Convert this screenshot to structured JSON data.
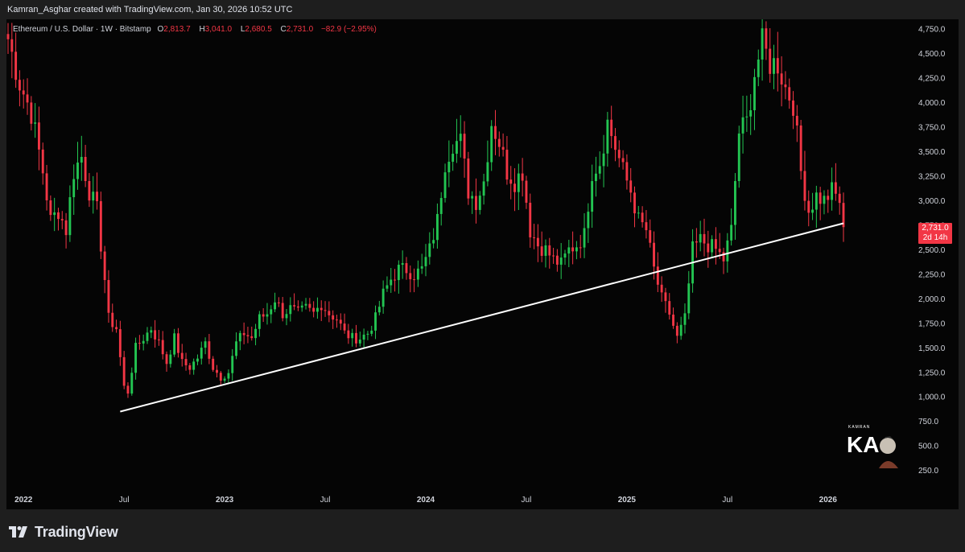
{
  "header": {
    "credit": "Kamran_Asghar created with TradingView.com, Jan 30, 2026 10:52 UTC"
  },
  "legend": {
    "symbol": "Ethereum / U.S. Dollar · 1W · Bitstamp",
    "open_label": "O",
    "open": "2,813.7",
    "high_label": "H",
    "high": "3,041.0",
    "low_label": "L",
    "low": "2,680.5",
    "close_label": "C",
    "close": "2,731.0",
    "change": "−82.9 (−2.95%)"
  },
  "price_tag": {
    "price": "2,731.0",
    "countdown": "2d 14h"
  },
  "watermark": {
    "text_top": "KAMRAN",
    "initials": "KA"
  },
  "footer": {
    "brand": "TradingView"
  },
  "colors": {
    "up": "#23c552",
    "down": "#f23645",
    "background": "#050505",
    "trendline": "#ffffff",
    "axis_text": "#d1d4dc"
  },
  "chart_data": {
    "type": "candlestick",
    "ylim": [
      50,
      4850
    ],
    "y_ticks": [
      250,
      500,
      750,
      1000,
      1250,
      1500,
      1750,
      2000,
      2250,
      2500,
      2750,
      3000,
      3250,
      3500,
      3750,
      4000,
      4250,
      4500,
      4750
    ],
    "y_tick_labels": [
      "250.0",
      "500.0",
      "750.0",
      "1,000.0",
      "1,250.0",
      "1,500.0",
      "1,750.0",
      "2,000.0",
      "2,250.0",
      "2,500.0",
      "2,750.0",
      "3,000.0",
      "3,250.0",
      "3,500.0",
      "3,750.0",
      "4,000.0",
      "4,250.0",
      "4,500.0",
      "4,750.0"
    ],
    "x_labels": [
      {
        "label": "2022",
        "index": 4,
        "bold": true
      },
      {
        "label": "Jul",
        "index": 30,
        "bold": false
      },
      {
        "label": "2023",
        "index": 56,
        "bold": true
      },
      {
        "label": "Jul",
        "index": 82,
        "bold": false
      },
      {
        "label": "2024",
        "index": 108,
        "bold": true
      },
      {
        "label": "Jul",
        "index": 134,
        "bold": false
      },
      {
        "label": "2025",
        "index": 160,
        "bold": true
      },
      {
        "label": "Jul",
        "index": 186,
        "bold": false
      },
      {
        "label": "2026",
        "index": 212,
        "bold": true
      }
    ],
    "trendline": [
      {
        "index": 29,
        "price": 850
      },
      {
        "index": 216,
        "price": 2770
      }
    ],
    "anchors": [
      [
        0,
        4650
      ],
      [
        1,
        4500
      ],
      [
        3,
        4200
      ],
      [
        6,
        3900
      ],
      [
        9,
        3300
      ],
      [
        11,
        2800
      ],
      [
        13,
        2900
      ],
      [
        15,
        2700
      ],
      [
        17,
        3300
      ],
      [
        19,
        3450
      ],
      [
        21,
        3100
      ],
      [
        23,
        2900
      ],
      [
        25,
        2200
      ],
      [
        26,
        1800
      ],
      [
        28,
        1700
      ],
      [
        30,
        1100
      ],
      [
        31,
        1050
      ],
      [
        33,
        1500
      ],
      [
        35,
        1600
      ],
      [
        37,
        1700
      ],
      [
        39,
        1550
      ],
      [
        41,
        1350
      ],
      [
        43,
        1600
      ],
      [
        45,
        1350
      ],
      [
        47,
        1300
      ],
      [
        49,
        1400
      ],
      [
        51,
        1550
      ],
      [
        53,
        1300
      ],
      [
        55,
        1200
      ],
      [
        57,
        1250
      ],
      [
        59,
        1550
      ],
      [
        61,
        1650
      ],
      [
        63,
        1600
      ],
      [
        65,
        1800
      ],
      [
        67,
        1850
      ],
      [
        69,
        2000
      ],
      [
        71,
        1850
      ],
      [
        73,
        1900
      ],
      [
        75,
        1850
      ],
      [
        77,
        1900
      ],
      [
        79,
        1850
      ],
      [
        81,
        1950
      ],
      [
        83,
        1850
      ],
      [
        85,
        1800
      ],
      [
        87,
        1650
      ],
      [
        89,
        1600
      ],
      [
        91,
        1600
      ],
      [
        93,
        1650
      ],
      [
        95,
        1800
      ],
      [
        97,
        2050
      ],
      [
        99,
        2200
      ],
      [
        101,
        2300
      ],
      [
        103,
        2300
      ],
      [
        105,
        2250
      ],
      [
        107,
        2300
      ],
      [
        109,
        2500
      ],
      [
        111,
        2800
      ],
      [
        113,
        3400
      ],
      [
        115,
        3600
      ],
      [
        117,
        3600
      ],
      [
        119,
        3100
      ],
      [
        121,
        3000
      ],
      [
        123,
        3200
      ],
      [
        125,
        3800
      ],
      [
        127,
        3600
      ],
      [
        129,
        3300
      ],
      [
        131,
        3200
      ],
      [
        133,
        3300
      ],
      [
        135,
        2700
      ],
      [
        137,
        2550
      ],
      [
        139,
        2500
      ],
      [
        141,
        2400
      ],
      [
        143,
        2350
      ],
      [
        145,
        2500
      ],
      [
        147,
        2550
      ],
      [
        149,
        2650
      ],
      [
        151,
        3300
      ],
      [
        153,
        3400
      ],
      [
        155,
        3800
      ],
      [
        157,
        3550
      ],
      [
        159,
        3300
      ],
      [
        161,
        3100
      ],
      [
        163,
        2800
      ],
      [
        165,
        2700
      ],
      [
        167,
        2300
      ],
      [
        169,
        2000
      ],
      [
        171,
        1850
      ],
      [
        173,
        1600
      ],
      [
        175,
        1800
      ],
      [
        177,
        2500
      ],
      [
        179,
        2600
      ],
      [
        181,
        2550
      ],
      [
        183,
        2500
      ],
      [
        185,
        2400
      ],
      [
        187,
        2700
      ],
      [
        189,
        3700
      ],
      [
        191,
        3800
      ],
      [
        193,
        4300
      ],
      [
        195,
        4600
      ],
      [
        197,
        4400
      ],
      [
        199,
        4400
      ],
      [
        201,
        4150
      ],
      [
        203,
        4000
      ],
      [
        205,
        3300
      ],
      [
        207,
        2900
      ],
      [
        209,
        3050
      ],
      [
        211,
        3000
      ],
      [
        213,
        3100
      ],
      [
        215,
        3000
      ],
      [
        216,
        2731
      ]
    ]
  }
}
